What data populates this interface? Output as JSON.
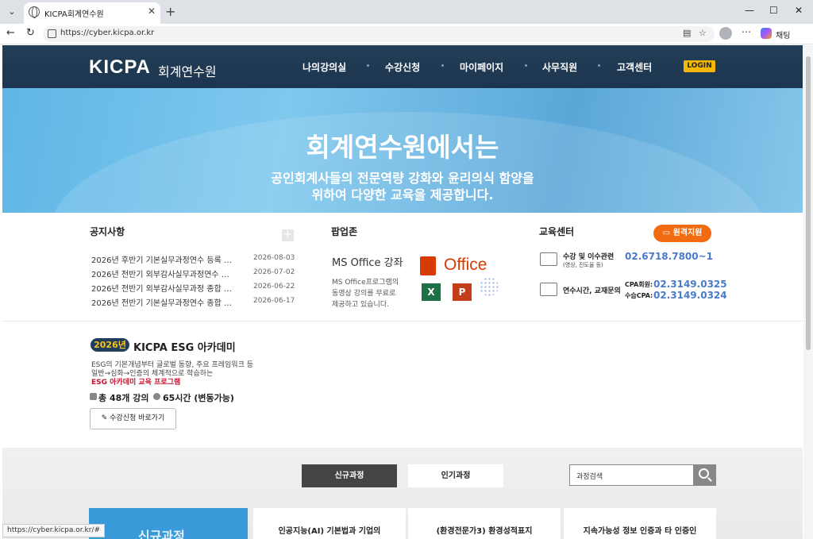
{
  "browser": {
    "tab_title": "KICPA회계연수원",
    "url": "https://cyber.kicpa.or.kr",
    "chat_label": "채팅",
    "status_url": "https://cyber.kicpa.or.kr/#"
  },
  "header": {
    "logo": "KICPA",
    "logo_sub": "회계연수원",
    "nav": [
      "나의강의실",
      "수강신청",
      "마이페이지",
      "사무직원",
      "고객센터"
    ],
    "login": "LOGIN"
  },
  "hero": {
    "title": "회계연수원에서는",
    "line1": "공인회계사들의 전문역량 강화와 윤리의식 함양을",
    "line2": "위하여 다양한 교육을 제공합니다."
  },
  "notice": {
    "title": "공지사항",
    "plus": "+",
    "items": [
      {
        "text": "2026년 후반기 기본실무과정연수 등록 …",
        "date": "2026-08-03"
      },
      {
        "text": "2026년 전반기 외부감사실무과정연수 …",
        "date": "2026-07-02"
      },
      {
        "text": "2026년 전반기 외부감사실무과정 종합 …",
        "date": "2026-06-22"
      },
      {
        "text": "2026년 전반기 기본실무과정연수 종합 …",
        "date": "2026-06-17"
      }
    ]
  },
  "popup": {
    "title": "팝업존",
    "heading": "MS Office 강좌",
    "desc1": "MS Office프로그램의",
    "desc2": "동영상 강의를 무료로",
    "desc3": "제공하고 있습니다.",
    "office_label": "Office",
    "excel": "X",
    "ppt": "P"
  },
  "edu_center": {
    "title": "교육센터",
    "remote_button": "원격지원",
    "row1_label": "수강 및 이수관련",
    "row1_sub": "(영상, 진도율 등)",
    "row1_phone": "02.6718.7800~1",
    "row2_label": "연수시간, 교재문의",
    "row2_cpa_label": "CPA회원:",
    "row2_cpa_phone": "02.3149.0325",
    "row2_trainee_label": "수습CPA:",
    "row2_trainee_phone": "02.3149.0324"
  },
  "esg": {
    "year": "2026년",
    "title": "KICPA ESG 아카데미",
    "desc1": "ESG의 기본개념부터 글로벌 동향, 주요 프레임워크 등",
    "desc2": "일반→심화→인증의 체계적으로 학습하는",
    "highlight": "ESG 아카데미 교육 프로그램",
    "total": "총 48개 강의",
    "hours": "65시간 (변동가능)",
    "button": "수강신청 바로가기"
  },
  "courses": {
    "tab_new": "신규과정",
    "tab_popular": "인기과정",
    "search_placeholder": "과정검색",
    "banner_label": "신규과정",
    "cards": [
      "인공지능(AI) 기본법과 기업의",
      "(환경전문가3) 환경성적표지",
      "지속가능성 정보 인증과 타 인증인"
    ]
  }
}
